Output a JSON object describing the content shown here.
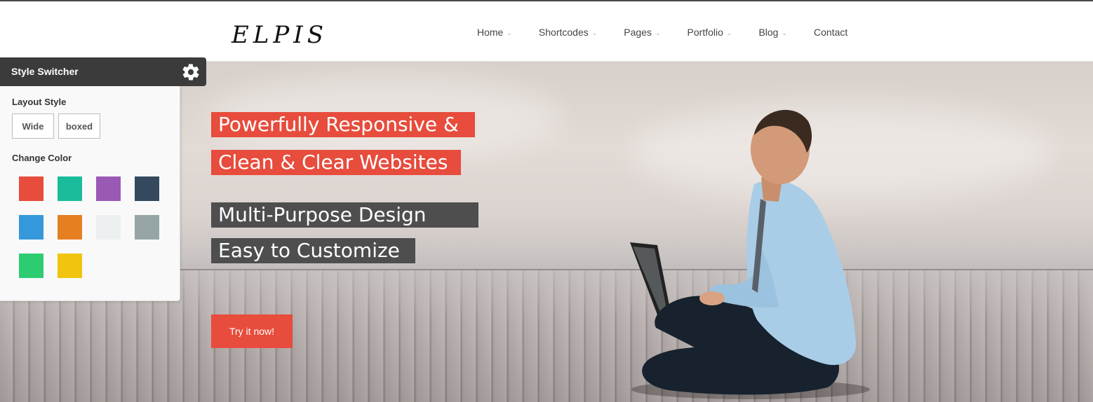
{
  "header": {
    "logo": "ELPIS",
    "nav": [
      {
        "label": "Home",
        "has_dropdown": true
      },
      {
        "label": "Shortcodes",
        "has_dropdown": true
      },
      {
        "label": "Pages",
        "has_dropdown": true
      },
      {
        "label": "Portfolio",
        "has_dropdown": true
      },
      {
        "label": "Blog",
        "has_dropdown": true
      },
      {
        "label": "Contact",
        "has_dropdown": false
      }
    ]
  },
  "hero": {
    "lines": [
      {
        "text": "Powerfully Responsive &",
        "style": "red"
      },
      {
        "text": "Clean & Clear Websites",
        "style": "red"
      },
      {
        "text": "Multi-Purpose Design",
        "style": "dark"
      },
      {
        "text": "Easy to Customize",
        "style": "dark"
      }
    ],
    "cta_label": "Try it now!"
  },
  "switcher": {
    "title": "Style Switcher",
    "gear_icon": "gear-icon",
    "layout_label": "Layout Style",
    "layout_options": [
      "Wide",
      "boxed"
    ],
    "color_label": "Change Color",
    "colors": [
      "#e74c3c",
      "#1abc9c",
      "#9b59b6",
      "#34495e",
      "#3498db",
      "#e67e22",
      "#ecf0f1",
      "#95a5a6",
      "#2ecc71",
      "#f1c40f"
    ]
  },
  "colors": {
    "accent": "#e74c3c",
    "dark_tag": "#4e4e4e",
    "switcher_header": "#3b3b3b"
  }
}
